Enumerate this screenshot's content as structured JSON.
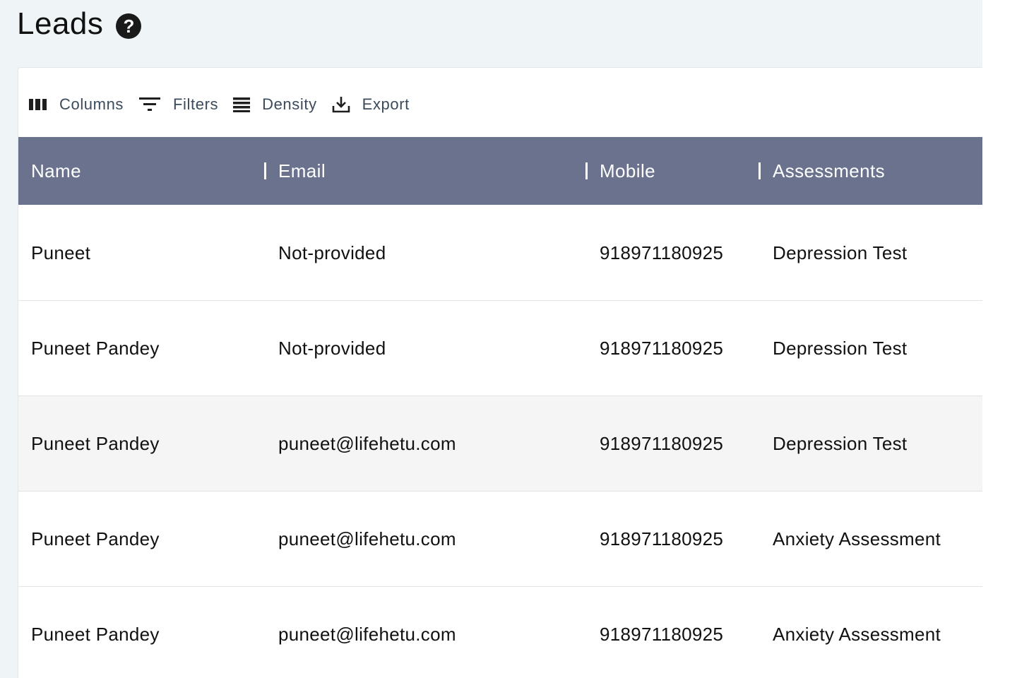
{
  "page": {
    "title": "Leads"
  },
  "toolbar": {
    "columns_label": "Columns",
    "filters_label": "Filters",
    "density_label": "Density",
    "export_label": "Export"
  },
  "table": {
    "columns": [
      "Name",
      "Email",
      "Mobile",
      "Assessments"
    ],
    "rows": [
      {
        "name": "Puneet",
        "email": "Not-provided",
        "mobile": "918971180925",
        "assessment": "Depression Test"
      },
      {
        "name": "Puneet Pandey",
        "email": "Not-provided",
        "mobile": "918971180925",
        "assessment": "Depression Test"
      },
      {
        "name": "Puneet Pandey",
        "email": "puneet@lifehetu.com",
        "mobile": "918971180925",
        "assessment": "Depression Test"
      },
      {
        "name": "Puneet Pandey",
        "email": "puneet@lifehetu.com",
        "mobile": "918971180925",
        "assessment": "Anxiety Assessment"
      },
      {
        "name": "Puneet Pandey",
        "email": "puneet@lifehetu.com",
        "mobile": "918971180925",
        "assessment": "Anxiety Assessment"
      }
    ]
  },
  "colors": {
    "header_bg": "#6b728e",
    "page_bg": "#eff4f7",
    "hover_row_bg": "#f5f5f5"
  }
}
